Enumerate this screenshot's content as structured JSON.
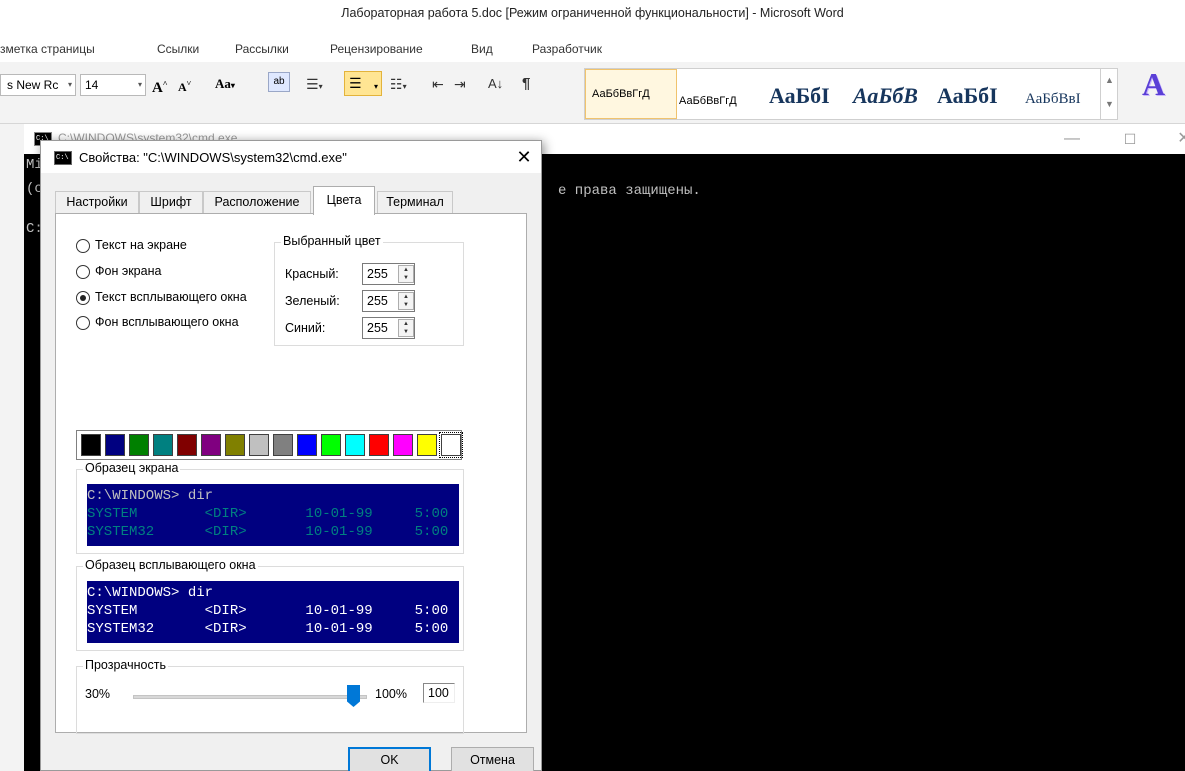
{
  "word": {
    "title": "Лабораторная работа 5.doc [Режим ограниченной функциональности]  -  Microsoft Word",
    "tabs": [
      "зметка страницы",
      "Ссылки",
      "Рассылки",
      "Рецензирование",
      "Вид",
      "Разработчик"
    ],
    "font_name": "s New Rc",
    "font_size": "14",
    "styles": [
      "АаБбВвГгД",
      "АаБбВвГгД",
      "АаБбI",
      "АаБбВ",
      "АаБбI",
      "АаБбВвI"
    ],
    "styles_big_glyph": "A"
  },
  "cmd": {
    "title": "C:\\WINDOWS\\system32\\cmd.exe",
    "left_chars": [
      "Mi",
      "(c",
      "C:"
    ],
    "rights_text": "е права защищены."
  },
  "dialog": {
    "title": "Свойства: \"C:\\WINDOWS\\system32\\cmd.exe\"",
    "tabs": [
      {
        "label": "Настройки",
        "active": false
      },
      {
        "label": "Шрифт",
        "active": false
      },
      {
        "label": "Расположение",
        "active": false
      },
      {
        "label": "Цвета",
        "active": true
      },
      {
        "label": "Терминал",
        "active": false
      }
    ],
    "radios": [
      {
        "label": "Текст на экране",
        "checked": false
      },
      {
        "label": "Фон экрана",
        "checked": false
      },
      {
        "label": "Текст всплывающего окна",
        "checked": true
      },
      {
        "label": "Фон всплывающего окна",
        "checked": false
      }
    ],
    "selected_color": {
      "legend": "Выбранный цвет",
      "red_label": "Красный:",
      "red": "255",
      "green_label": "Зеленый:",
      "green": "255",
      "blue_label": "Синий:",
      "blue": "255"
    },
    "palette": [
      "#000000",
      "#000080",
      "#008000",
      "#008080",
      "#800000",
      "#800080",
      "#808000",
      "#c0c0c0",
      "#808080",
      "#0000ff",
      "#00ff00",
      "#00ffff",
      "#ff0000",
      "#ff00ff",
      "#ffff00",
      "#ffffff"
    ],
    "palette_selected": 15,
    "screen_preview": {
      "legend": "Образец экрана",
      "bg": "#000080",
      "header_color": "#c0c0c0",
      "row_color": "#008080",
      "lines": [
        "C:\\WINDOWS> dir",
        "SYSTEM        <DIR>       10-01-99     5:00",
        "SYSTEM32      <DIR>       10-01-99     5:00"
      ]
    },
    "popup_preview": {
      "legend": "Образец всплывающего окна",
      "bg": "#000080",
      "header_color": "#ffffff",
      "row_color": "#ffffff",
      "lines": [
        "C:\\WINDOWS> dir",
        "SYSTEM        <DIR>       10-01-99     5:00",
        "SYSTEM32      <DIR>       10-01-99     5:00"
      ]
    },
    "transparency": {
      "legend": "Прозрачность",
      "min_label": "30%",
      "max_label": "100%",
      "value": "100"
    },
    "ok_label": "OK",
    "cancel_label": "Отмена"
  }
}
